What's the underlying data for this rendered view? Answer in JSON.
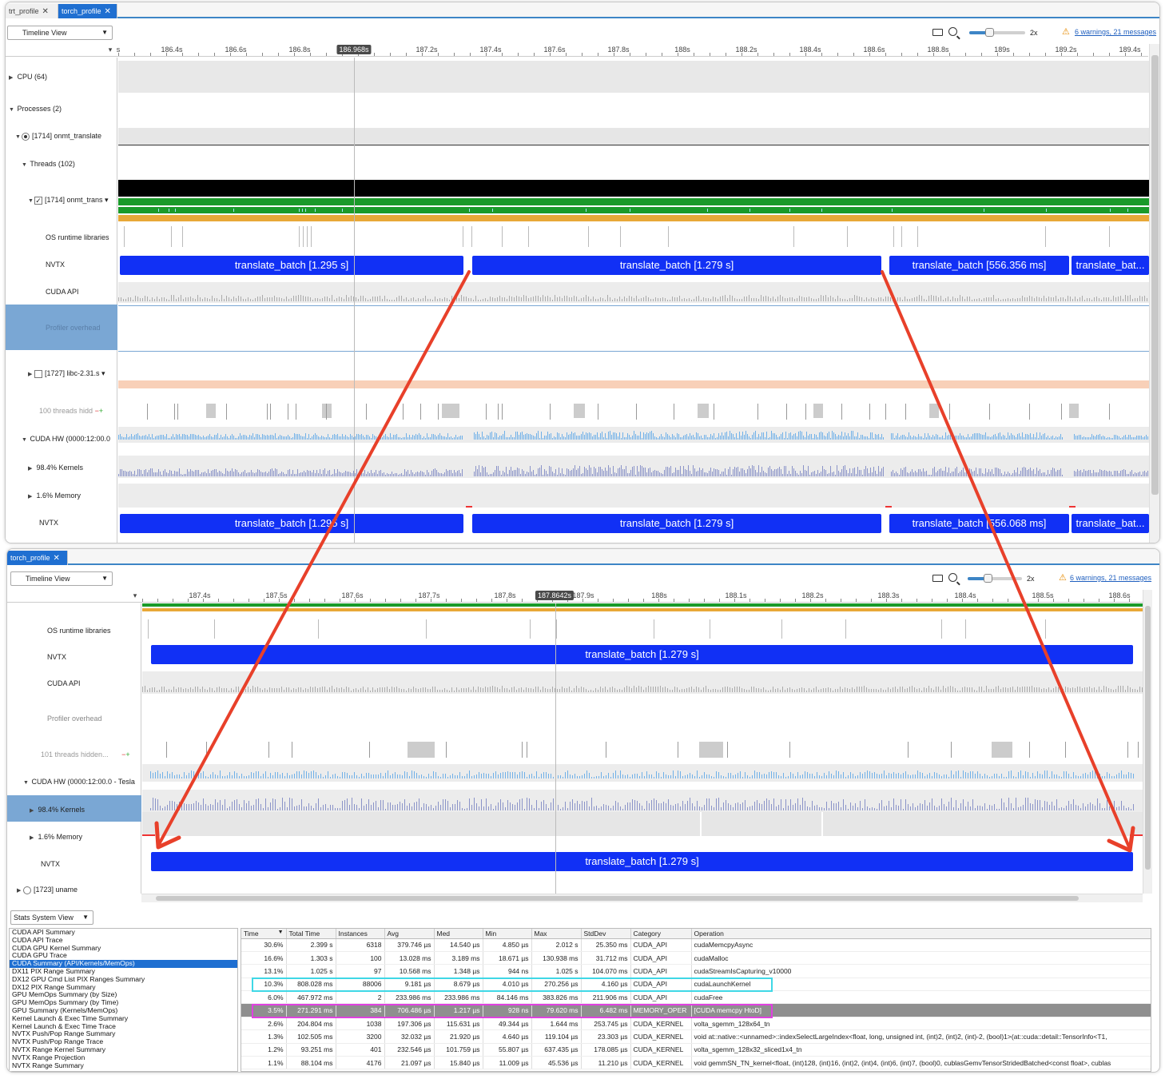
{
  "top": {
    "tabs": [
      {
        "label": "trt_profile",
        "active": false
      },
      {
        "label": "torch_profile",
        "active": true
      }
    ],
    "view_select": "Timeline View",
    "zoom_label": "2x",
    "warnings": "6 warnings, 21 messages",
    "ticks": [
      "s",
      "186.4s",
      "186.6s",
      "186.8s",
      "187s",
      "187.2s",
      "187.4s",
      "187.6s",
      "187.8s",
      "188s",
      "188.2s",
      "188.4s",
      "188.6s",
      "188.8s",
      "189s",
      "189.2s",
      "189.4s"
    ],
    "cursor": "186.968s",
    "rows": {
      "cpu": "CPU (64)",
      "processes": "Processes (2)",
      "process": "[1714] onmt_translate",
      "threads": "Threads (102)",
      "thread": "[1714] onmt_trans",
      "os_runtime": "OS runtime libraries",
      "nvtx": "NVTX",
      "cuda_api": "CUDA API",
      "profiler_overhead": "Profiler overhead",
      "libc": "[1727] libc-2.31.s",
      "hidden_threads": "100 threads hidd",
      "cuda_hw": "CUDA HW (0000:12:00.0",
      "kernels": "98.4% Kernels",
      "memory": "1.6% Memory",
      "nvtx2": "NVTX"
    },
    "nvtx_bars": [
      "translate_batch [1.295 s]",
      "translate_batch [1.279 s]",
      "translate_batch [556.356 ms]",
      "translate_bat..."
    ],
    "nvtx_bars2": [
      "translate_batch [1.295 s]",
      "translate_batch [1.279 s]",
      "translate_batch [556.068 ms]",
      "translate_bat..."
    ]
  },
  "bottom": {
    "tabs": [
      {
        "label": "torch_profile",
        "active": true
      }
    ],
    "view_select": "Timeline View",
    "zoom_label": "2x",
    "warnings": "6 warnings, 21 messages",
    "ticks": [
      "187.4s",
      "187.5s",
      "187.6s",
      "187.7s",
      "187.8s",
      "187.9s",
      "188s",
      "188.1s",
      "188.2s",
      "188.3s",
      "188.4s",
      "188.5s",
      "188.6s"
    ],
    "cursor": "187.8642s",
    "rows": {
      "os_runtime": "OS runtime libraries",
      "nvtx": "NVTX",
      "cuda_api": "CUDA API",
      "profiler_overhead": "Profiler overhead",
      "hidden_threads": "101 threads hidden...",
      "cuda_hw": "CUDA HW (0000:12:00.0 - Tesla",
      "kernels": "98.4% Kernels",
      "memory": "1.6% Memory",
      "nvtx2": "NVTX",
      "uname": "[1723] uname"
    },
    "nvtx_bar": "translate_batch [1.279 s]",
    "nvtx_bar2": "translate_batch [1.279 s]",
    "stats_select": "Stats System View",
    "reports": [
      "CUDA API Summary",
      "CUDA API Trace",
      "CUDA GPU Kernel Summary",
      "CUDA GPU Trace",
      "CUDA Summary (API/Kernels/MemOps)",
      "DX11 PIX Range Summary",
      "DX12 GPU Cmd List PIX Ranges Summary",
      "DX12 PIX Range Summary",
      "GPU MemOps Summary (by Size)",
      "GPU MemOps Summary (by Time)",
      "GPU Summary (Kernels/MemOps)",
      "Kernel Launch & Exec Time Summary",
      "Kernel Launch & Exec Time Trace",
      "NVTX Push/Pop Range Summary",
      "NVTX Push/Pop Range Trace",
      "NVTX Range Kernel Summary",
      "NVTX Range Projection",
      "NVTX Range Summary"
    ],
    "selected_report": 4,
    "table": {
      "columns": [
        "Time",
        "Total Time",
        "Instances",
        "Avg",
        "Med",
        "Min",
        "Max",
        "StdDev",
        "Category",
        "Operation"
      ],
      "rows": [
        [
          "30.6%",
          "2.399 s",
          "6318",
          "379.746 µs",
          "14.540 µs",
          "4.850 µs",
          "2.012 s",
          "25.350 ms",
          "CUDA_API",
          "cudaMemcpyAsync"
        ],
        [
          "16.6%",
          "1.303 s",
          "100",
          "13.028 ms",
          "3.189 ms",
          "18.671 µs",
          "130.938 ms",
          "31.712 ms",
          "CUDA_API",
          "cudaMalloc"
        ],
        [
          "13.1%",
          "1.025 s",
          "97",
          "10.568 ms",
          "1.348 µs",
          "944 ns",
          "1.025 s",
          "104.070 ms",
          "CUDA_API",
          "cudaStreamIsCapturing_v10000"
        ],
        [
          "10.3%",
          "808.028 ms",
          "88006",
          "9.181 µs",
          "8.679 µs",
          "4.010 µs",
          "270.256 µs",
          "4.160 µs",
          "CUDA_API",
          "cudaLaunchKernel"
        ],
        [
          "6.0%",
          "467.972 ms",
          "2",
          "233.986 ms",
          "233.986 ms",
          "84.146 ms",
          "383.826 ms",
          "211.906 ms",
          "CUDA_API",
          "cudaFree"
        ],
        [
          "3.5%",
          "271.291 ms",
          "384",
          "706.486 µs",
          "1.217 µs",
          "928 ns",
          "79.620 ms",
          "6.482 ms",
          "MEMORY_OPER",
          "[CUDA memcpy HtoD]"
        ],
        [
          "2.6%",
          "204.804 ms",
          "1038",
          "197.306 µs",
          "115.631 µs",
          "49.344 µs",
          "1.644 ms",
          "253.745 µs",
          "CUDA_KERNEL",
          "volta_sgemm_128x64_tn"
        ],
        [
          "1.3%",
          "102.505 ms",
          "3200",
          "32.032 µs",
          "21.920 µs",
          "4.640 µs",
          "119.104 µs",
          "23.303 µs",
          "CUDA_KERNEL",
          "void at::native::<unnamed>::indexSelectLargeIndex<float, long, unsigned int, (int)2, (int)2, (int)-2, (bool)1>(at::cuda::detail::TensorInfo<T1,"
        ],
        [
          "1.2%",
          "93.251 ms",
          "401",
          "232.546 µs",
          "101.759 µs",
          "55.807 µs",
          "637.435 µs",
          "178.085 µs",
          "CUDA_KERNEL",
          "volta_sgemm_128x32_sliced1x4_tn"
        ],
        [
          "1.1%",
          "88.104 ms",
          "4176",
          "21.097 µs",
          "15.840 µs",
          "11.009 µs",
          "45.536 µs",
          "11.210 µs",
          "CUDA_KERNEL",
          "void gemmSN_TN_kernel<float, (int)128, (int)16, (int)2, (int)4, (int)6, (int)7, (bool)0, cublasGemvTensorStridedBatched<const float>, cublas"
        ]
      ],
      "selected_row": 5,
      "cyan_row": 3,
      "magenta_row": 5
    }
  },
  "colors": {
    "nvtx_blue": "#1130f5",
    "arrow_red": "#e8402a",
    "cyan_outline": "#3fd8e6",
    "magenta_outline": "#e040e0",
    "cuda_light": "#6fb0e8",
    "kernel_purple": "#8a93c8"
  }
}
